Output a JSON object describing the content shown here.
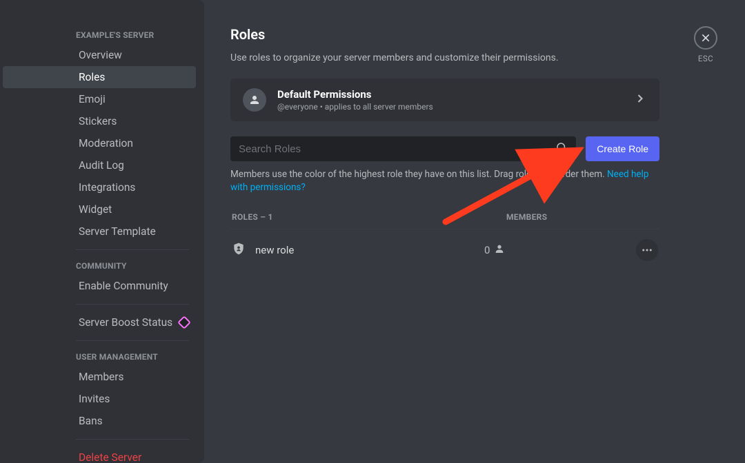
{
  "sidebar": {
    "serverHeader": "EXAMPLE'S SERVER",
    "items1": [
      {
        "label": "Overview"
      },
      {
        "label": "Roles",
        "active": true
      },
      {
        "label": "Emoji"
      },
      {
        "label": "Stickers"
      },
      {
        "label": "Moderation"
      },
      {
        "label": "Audit Log"
      },
      {
        "label": "Integrations"
      },
      {
        "label": "Widget"
      },
      {
        "label": "Server Template"
      }
    ],
    "communityHeader": "COMMUNITY",
    "items2": [
      {
        "label": "Enable Community"
      }
    ],
    "boost": {
      "label": "Server Boost Status"
    },
    "userMgmtHeader": "USER MANAGEMENT",
    "items3": [
      {
        "label": "Members"
      },
      {
        "label": "Invites"
      },
      {
        "label": "Bans"
      }
    ],
    "delete": "Delete Server"
  },
  "main": {
    "title": "Roles",
    "subtitle": "Use roles to organize your server members and customize their permissions.",
    "defaultPerms": {
      "title": "Default Permissions",
      "subtitle": "@everyone • applies to all server members"
    },
    "search": {
      "placeholder": "Search Roles"
    },
    "createBtn": "Create Role",
    "hintText": "Members use the color of the highest role they have on this list. Drag roles to reorder them. ",
    "hintLink": "Need help with permissions?",
    "table": {
      "rolesHeader": "ROLES – 1",
      "membersHeader": "MEMBERS",
      "rows": [
        {
          "name": "new role",
          "members": "0"
        }
      ]
    }
  },
  "close": {
    "label": "ESC"
  }
}
